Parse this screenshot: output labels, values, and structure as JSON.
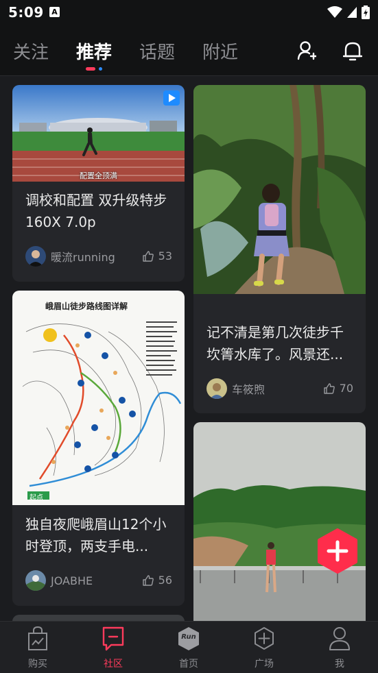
{
  "status_bar": {
    "time": "5:09",
    "a_icon_letter": "A"
  },
  "tabs": [
    {
      "label": "关注",
      "active": false
    },
    {
      "label": "推荐",
      "active": true
    },
    {
      "label": "话题",
      "active": false
    },
    {
      "label": "附近",
      "active": false
    }
  ],
  "feed": {
    "card1": {
      "image_caption": "配置全顶满",
      "title": "调校和配置 双升级特步160X 7.0p",
      "author": "暖流running",
      "likes": "53"
    },
    "card2": {
      "image_title": "峨眉山徒步路线图详解",
      "start_label": "起点",
      "title": "独自夜爬峨眉山12个小时登顶，两支手电...",
      "author": "JOABHE",
      "likes": "56"
    },
    "card3": {
      "title": "记不清是第几次徒步千坎箐水库了。风景还...",
      "author": "车筱煦",
      "likes": "70"
    }
  },
  "fab": {
    "label": "+"
  },
  "bottom_nav": [
    {
      "label": "购买",
      "icon": "bag-icon",
      "active": false
    },
    {
      "label": "社区",
      "icon": "message-square-icon",
      "active": true
    },
    {
      "label": "首页",
      "icon": "run-logo-icon",
      "logo_text": "Run",
      "active": false
    },
    {
      "label": "广场",
      "icon": "plus-circle-icon",
      "active": false
    },
    {
      "label": "我",
      "icon": "person-icon",
      "active": false
    }
  ],
  "colors": {
    "accent": "#ff3b5c",
    "indicator_blue": "#2c8cff",
    "background": "#1b1c1f",
    "card": "#25262a"
  }
}
